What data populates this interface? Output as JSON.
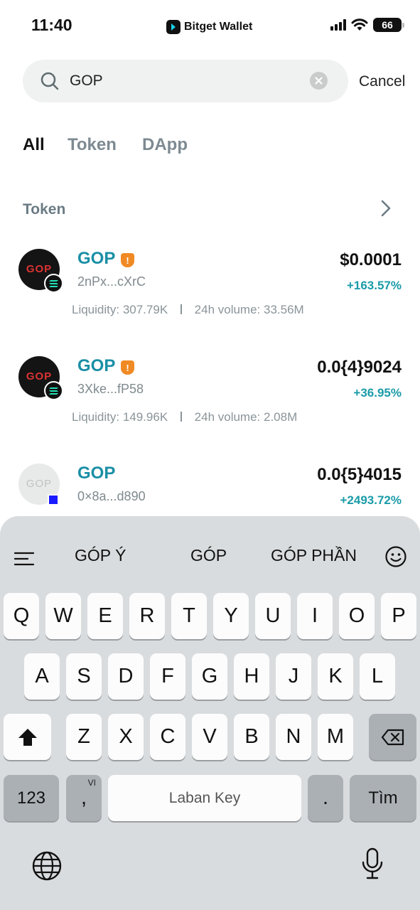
{
  "status_bar": {
    "time": "11:40",
    "app_brand": "Bitget Wallet",
    "battery": "66"
  },
  "search": {
    "value": "GOP",
    "cancel_label": "Cancel"
  },
  "tabs": [
    {
      "label": "All",
      "active": true
    },
    {
      "label": "Token",
      "active": false
    },
    {
      "label": "DApp",
      "active": false
    }
  ],
  "section": {
    "title": "Token"
  },
  "tokens": [
    {
      "name": "GOP",
      "address": "2nPx...cXrC",
      "price": "$0.0001",
      "change": "+163.57%",
      "liquidity": "Liquidity: 307.79K",
      "volume": "24h volume: 33.56M",
      "avatar_text": "GOP",
      "chain": "solana-icon",
      "warning": true
    },
    {
      "name": "GOP",
      "address": "3Xke...fP58",
      "price": "0.0{4}9024",
      "change": "+36.95%",
      "liquidity": "Liquidity: 149.96K",
      "volume": "24h volume: 2.08M",
      "avatar_text": "GOP",
      "chain": "solana-icon",
      "warning": true
    },
    {
      "name": "GOP",
      "address": "0×8a...d890",
      "price": "0.0{5}4015",
      "change": "+2493.72%",
      "avatar_text": "GOP",
      "chain": "blue-square-chain-icon",
      "warning": false
    }
  ],
  "keyboard": {
    "suggestions": [
      "GÓP Ý",
      "GÓP",
      "GÓP PHẦN"
    ],
    "row1": [
      "Q",
      "W",
      "E",
      "R",
      "T",
      "Y",
      "U",
      "I",
      "O",
      "P"
    ],
    "row2": [
      "A",
      "S",
      "D",
      "F",
      "G",
      "H",
      "J",
      "K",
      "L"
    ],
    "row3": [
      "Z",
      "X",
      "C",
      "V",
      "B",
      "N",
      "M"
    ],
    "numbers_label": "123",
    "comma_label": ",",
    "lang_label": "VI",
    "space_label": "Laban Key",
    "period_label": ".",
    "return_label": "Tìm"
  },
  "colors": {
    "accent": "#1a8fa6",
    "positive": "#1a9ba8",
    "warning": "#f08a24"
  }
}
